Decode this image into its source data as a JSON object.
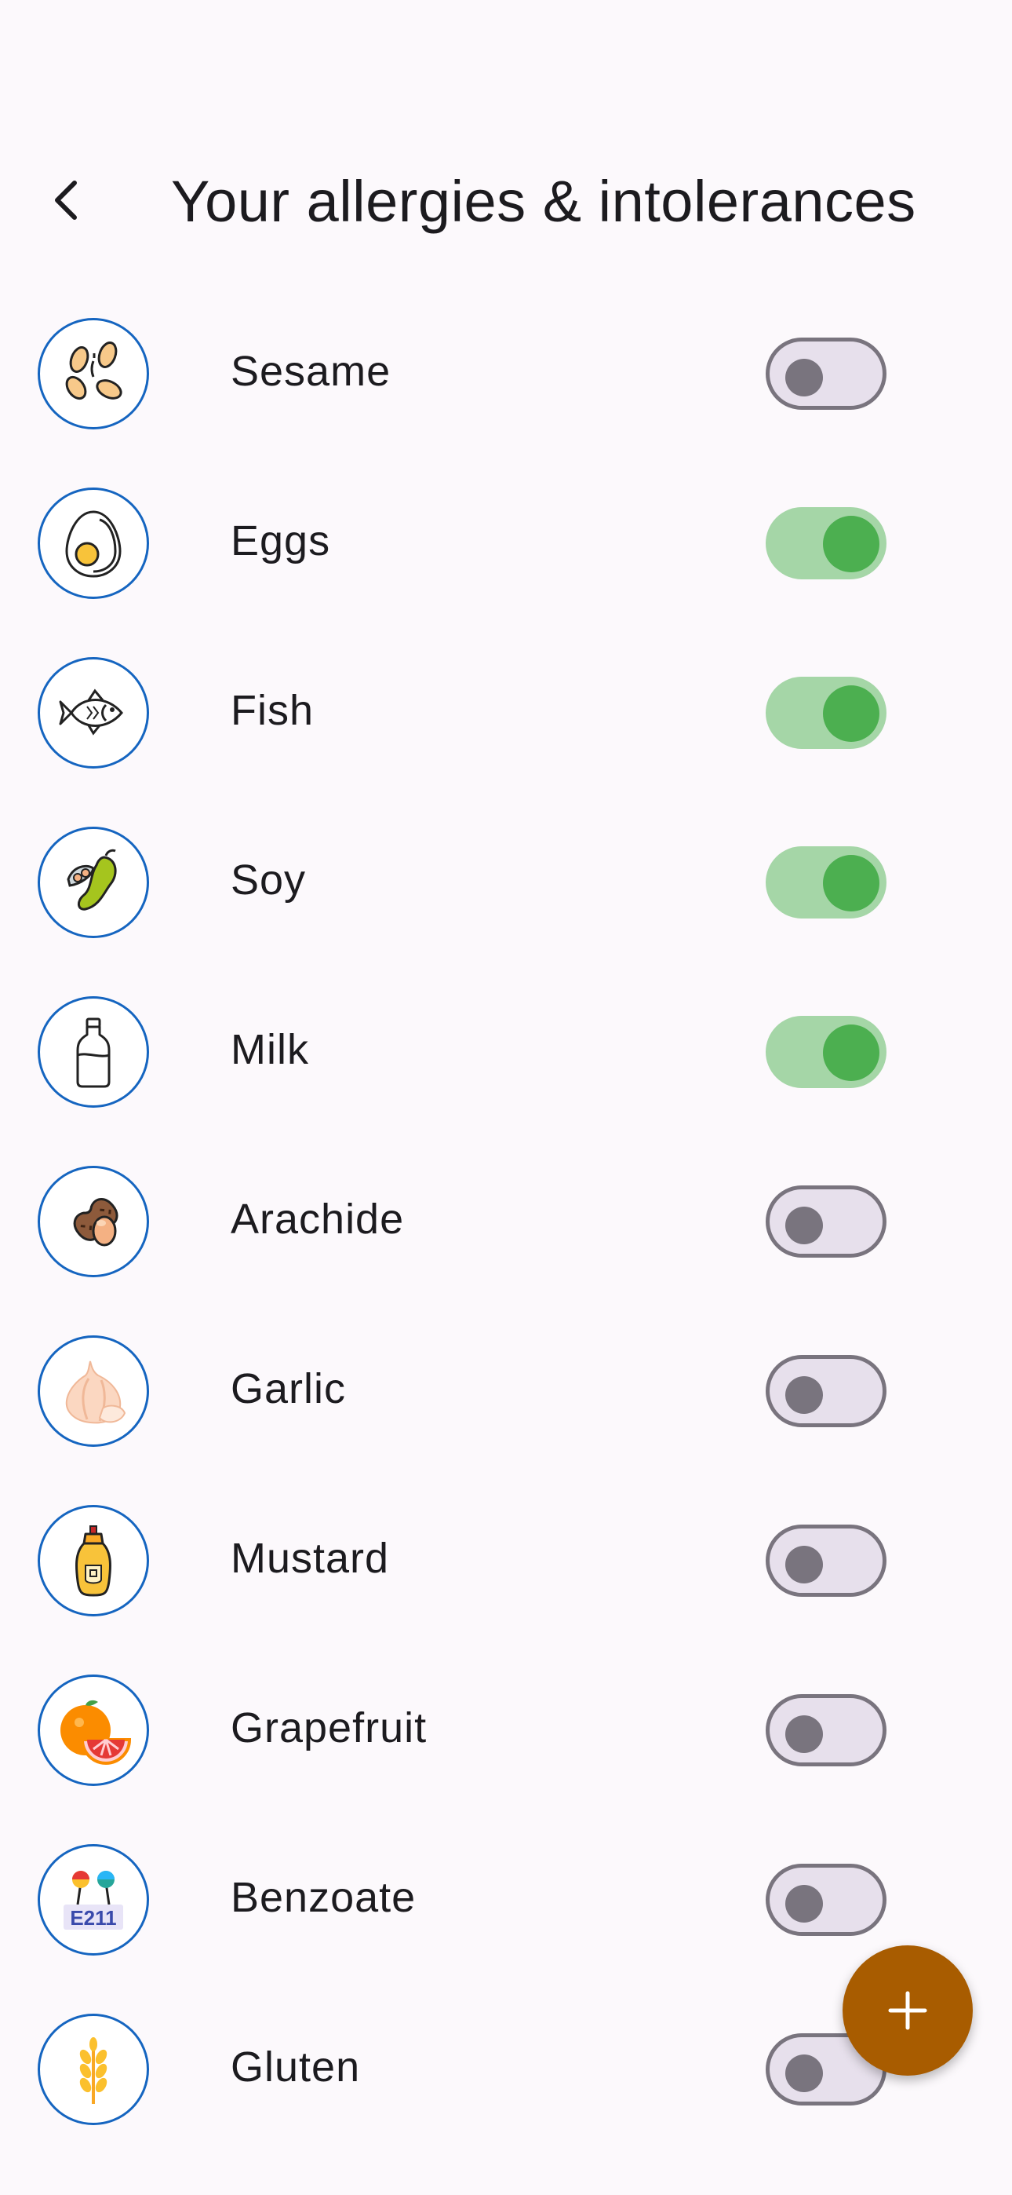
{
  "header": {
    "title": "Your allergies & intolerances",
    "back_icon": "chevron-left-icon"
  },
  "allergens": [
    {
      "id": "sesame",
      "label": "Sesame",
      "icon": "sesame-icon",
      "enabled": false
    },
    {
      "id": "eggs",
      "label": "Eggs",
      "icon": "egg-icon",
      "enabled": true
    },
    {
      "id": "fish",
      "label": "Fish",
      "icon": "fish-icon",
      "enabled": true
    },
    {
      "id": "soy",
      "label": "Soy",
      "icon": "soy-icon",
      "enabled": true
    },
    {
      "id": "milk",
      "label": "Milk",
      "icon": "milk-bottle-icon",
      "enabled": true
    },
    {
      "id": "arachide",
      "label": "Arachide",
      "icon": "peanut-icon",
      "enabled": false
    },
    {
      "id": "garlic",
      "label": "Garlic",
      "icon": "garlic-icon",
      "enabled": false
    },
    {
      "id": "mustard",
      "label": "Mustard",
      "icon": "mustard-icon",
      "enabled": false
    },
    {
      "id": "grapefruit",
      "label": "Grapefruit",
      "icon": "grapefruit-icon",
      "enabled": false
    },
    {
      "id": "benzoate",
      "label": "Benzoate",
      "icon": "benzoate-icon",
      "icon_text": "E211",
      "enabled": false
    },
    {
      "id": "gluten",
      "label": "Gluten",
      "icon": "wheat-icon",
      "enabled": false
    }
  ],
  "fab": {
    "icon": "plus-icon"
  },
  "colors": {
    "switch_on_track": "#a5d6a7",
    "switch_on_thumb": "#4caf50",
    "switch_off_track": "#e7e0ec",
    "switch_off_outline": "#79747e",
    "avatar_border": "#1565c0",
    "fab": "#a85c00"
  }
}
